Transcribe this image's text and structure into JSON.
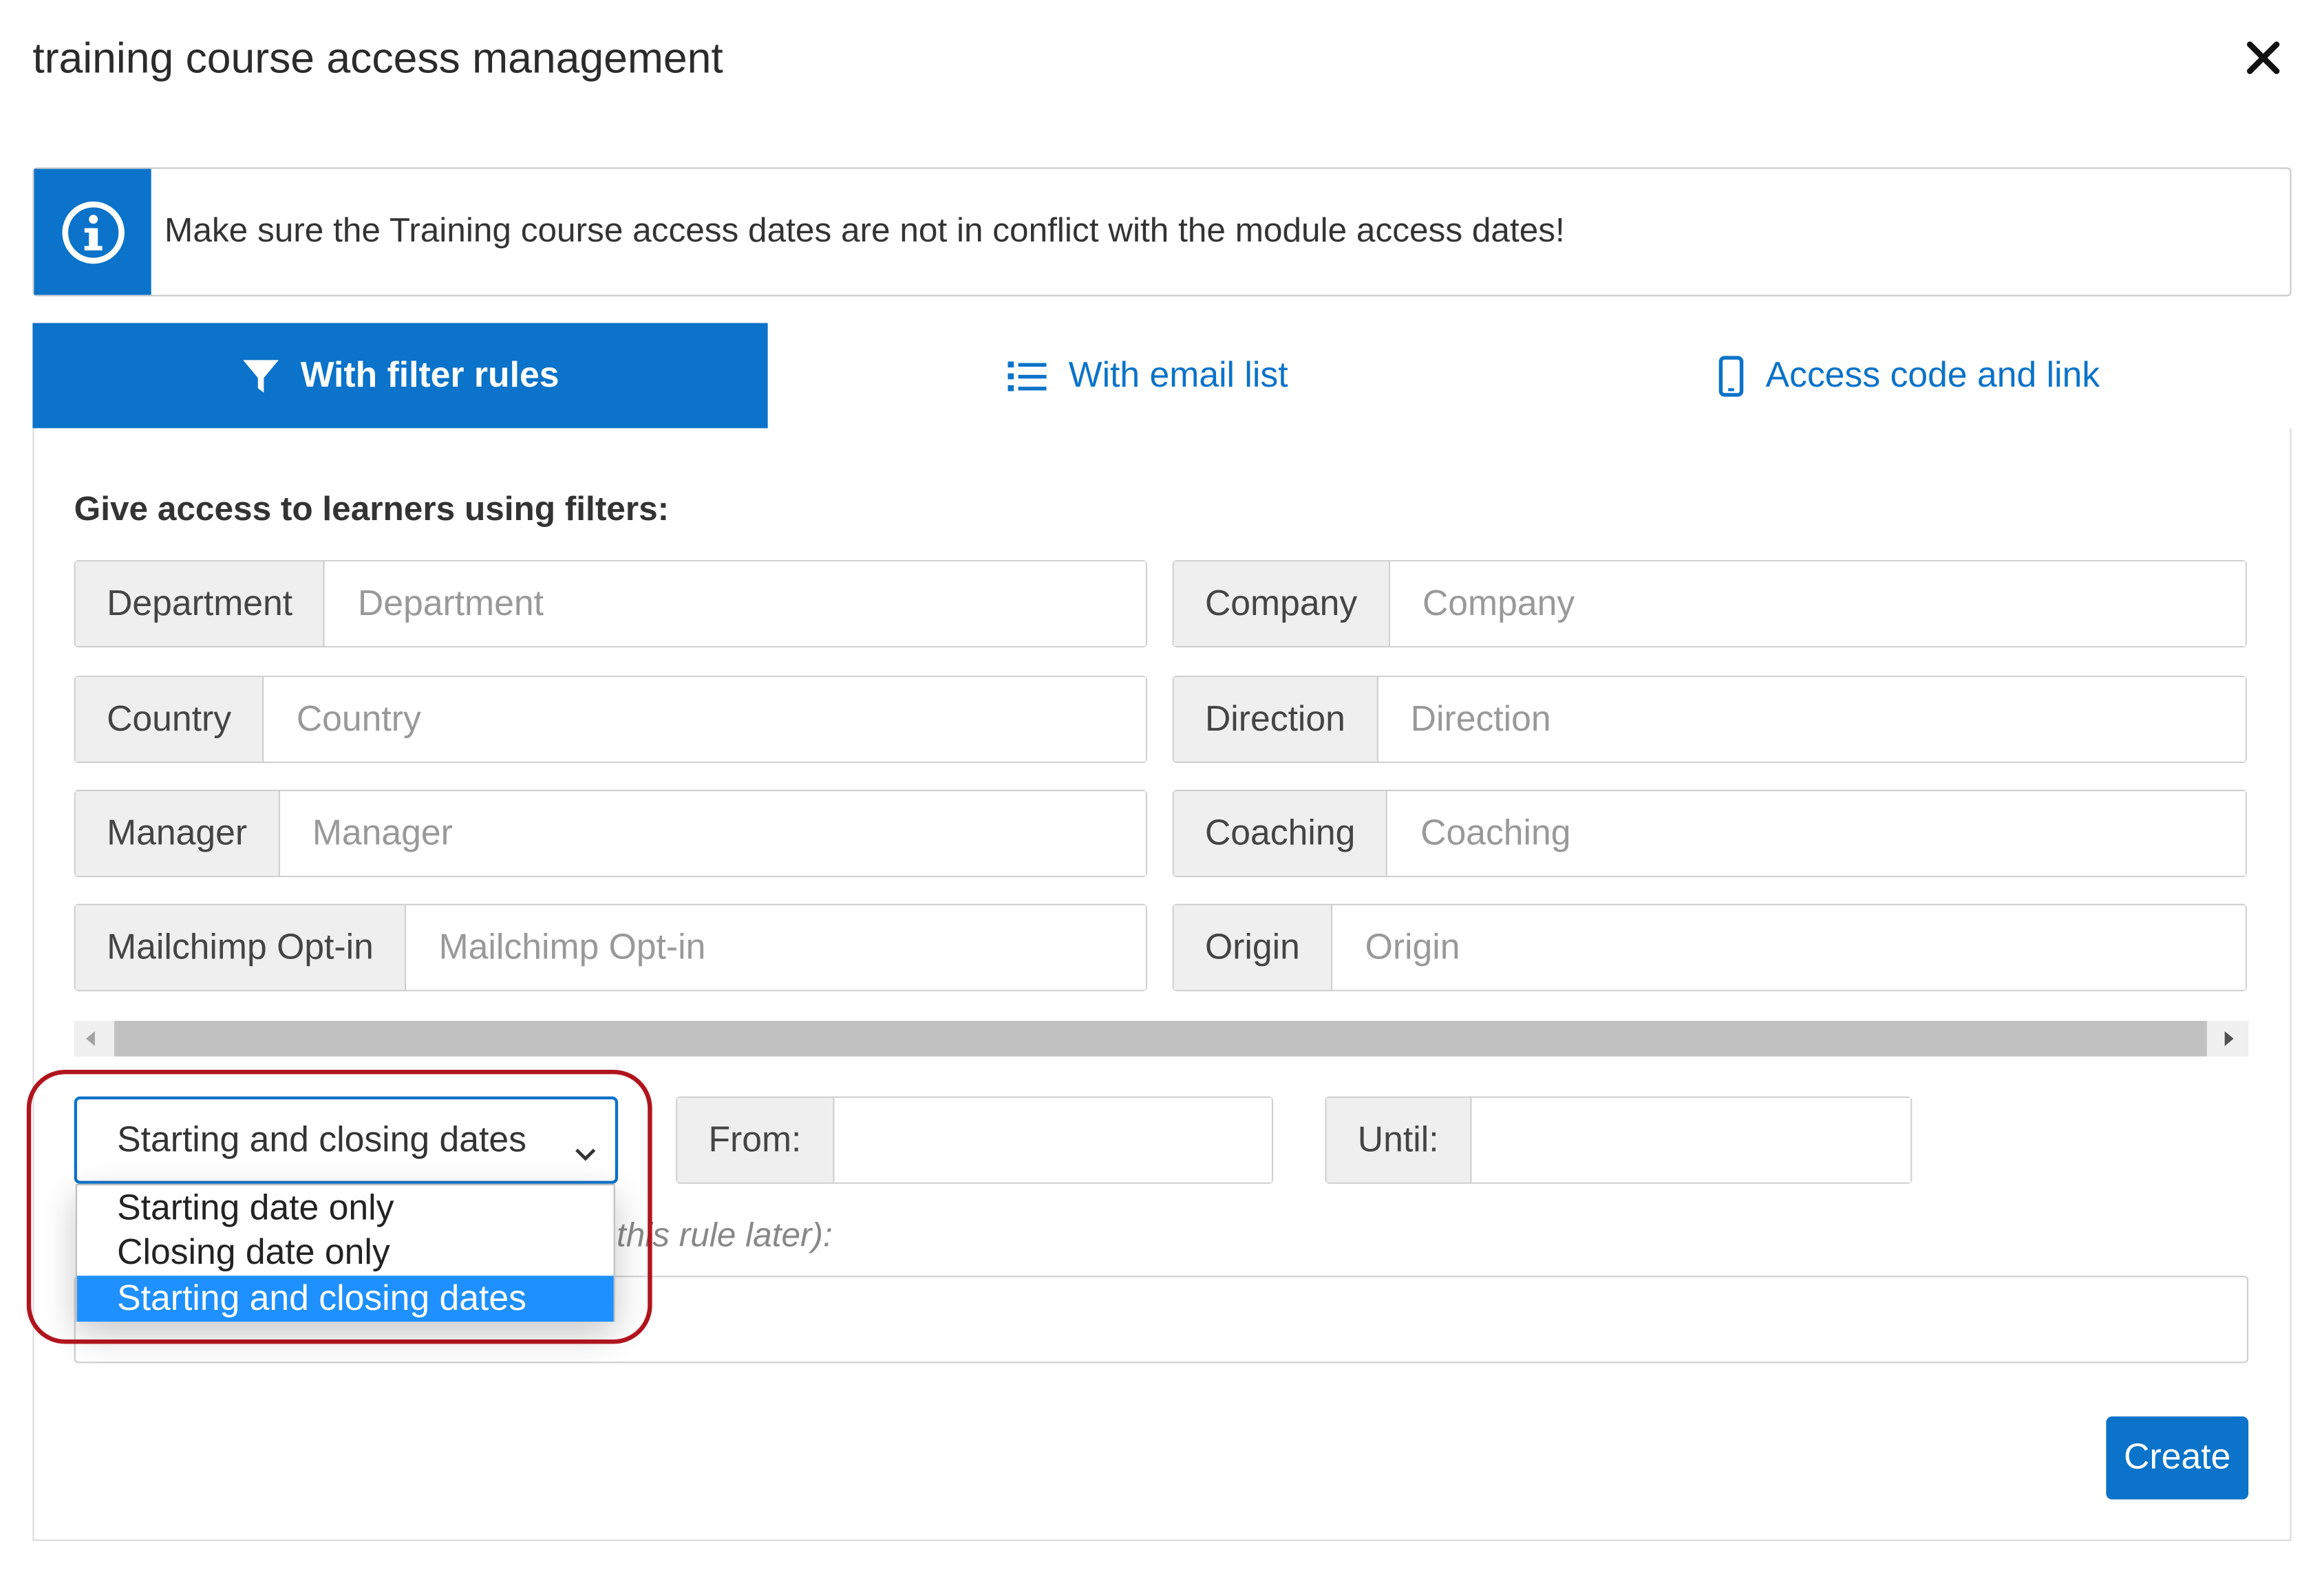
{
  "dialog": {
    "title": "training course access management"
  },
  "alert": {
    "icon": "info-circle-icon",
    "message": "Make sure the Training course access dates are not in conflict with the module access dates!"
  },
  "tabs": [
    {
      "label": "With filter rules",
      "icon": "filter-icon",
      "active": true
    },
    {
      "label": "With email list",
      "icon": "list-icon",
      "active": false
    },
    {
      "label": "Access code and link",
      "icon": "mobile-icon",
      "active": false
    }
  ],
  "filters": {
    "heading": "Give access to learners using filters:",
    "fields": [
      {
        "label": "Department",
        "placeholder": "Department",
        "value": ""
      },
      {
        "label": "Company",
        "placeholder": "Company",
        "value": ""
      },
      {
        "label": "Country",
        "placeholder": "Country",
        "value": ""
      },
      {
        "label": "Direction",
        "placeholder": "Direction",
        "value": ""
      },
      {
        "label": "Manager",
        "placeholder": "Manager",
        "value": ""
      },
      {
        "label": "Coaching",
        "placeholder": "Coaching",
        "value": ""
      },
      {
        "label": "Mailchimp Opt-in",
        "placeholder": "Mailchimp Opt-in",
        "value": ""
      },
      {
        "label": "Origin",
        "placeholder": "Origin",
        "value": ""
      }
    ]
  },
  "dates": {
    "mode_selected": "Starting and closing dates",
    "mode_options": [
      "Starting date only",
      "Closing date only",
      "Starting and closing dates"
    ],
    "from_label": "From:",
    "from_value": "",
    "until_label": "Until:",
    "until_value": ""
  },
  "rule_name": {
    "partial_label": "this rule later):",
    "value": ""
  },
  "actions": {
    "create_label": "Create"
  },
  "colors": {
    "primary": "#0b73c9",
    "highlight": "#b0151e",
    "dropdown_selected": "#1e90ff"
  }
}
